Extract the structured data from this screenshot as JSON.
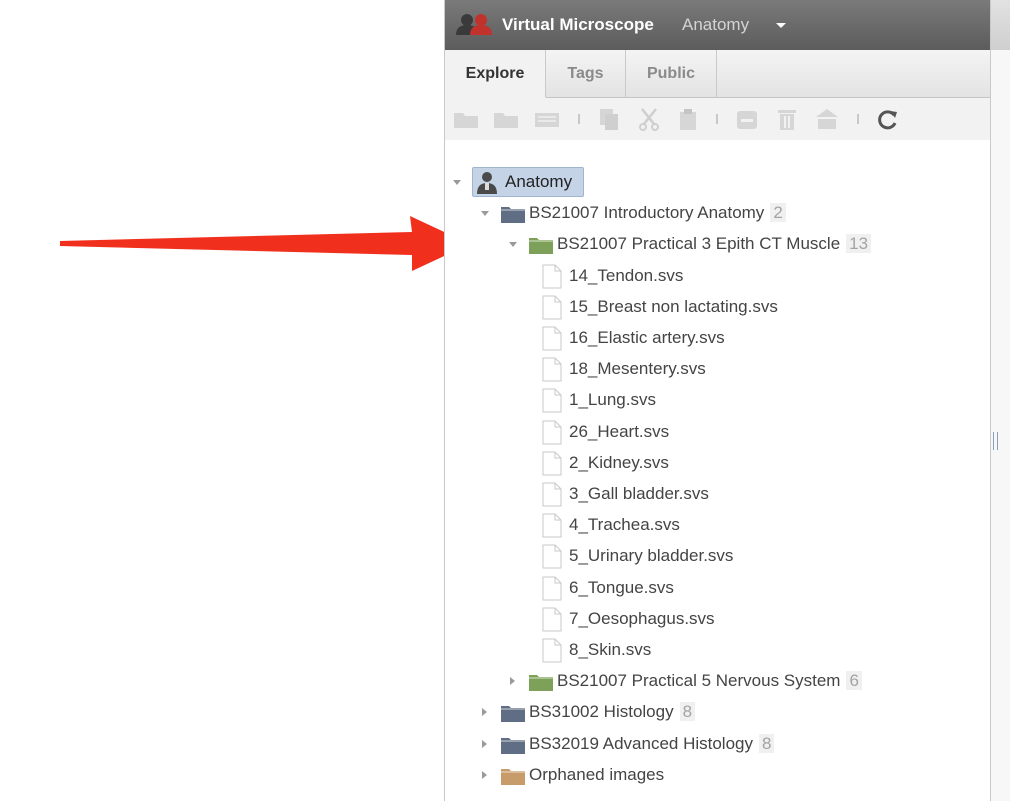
{
  "app": {
    "title": "Virtual Microscope",
    "context": "Anatomy"
  },
  "tabs": [
    {
      "label": "Explore",
      "active": true
    },
    {
      "label": "Tags",
      "active": false
    },
    {
      "label": "Public",
      "active": false
    }
  ],
  "toolbar": {
    "icons": [
      "new-folder-icon",
      "new-project-icon",
      "new-tag-icon",
      "copy-icon",
      "cut-icon",
      "paste-icon",
      "remove-icon",
      "delete-icon",
      "chgrp-icon",
      "refresh-icon"
    ]
  },
  "tree": {
    "root": {
      "label": "Anatomy"
    },
    "items": [
      {
        "label": "BS21007 Introductory Anatomy",
        "count": "2",
        "type": "project"
      },
      {
        "label": "BS21007 Practical 3 Epith CT Muscle",
        "count": "13",
        "type": "dataset"
      },
      {
        "label": "14_Tendon.svs",
        "type": "image"
      },
      {
        "label": "15_Breast non lactating.svs",
        "type": "image"
      },
      {
        "label": "16_Elastic artery.svs",
        "type": "image"
      },
      {
        "label": "18_Mesentery.svs",
        "type": "image"
      },
      {
        "label": "1_Lung.svs",
        "type": "image"
      },
      {
        "label": "26_Heart.svs",
        "type": "image"
      },
      {
        "label": "2_Kidney.svs",
        "type": "image"
      },
      {
        "label": "3_Gall bladder.svs",
        "type": "image"
      },
      {
        "label": "4_Trachea.svs",
        "type": "image"
      },
      {
        "label": "5_Urinary bladder.svs",
        "type": "image"
      },
      {
        "label": "6_Tongue.svs",
        "type": "image"
      },
      {
        "label": "7_Oesophagus.svs",
        "type": "image"
      },
      {
        "label": "8_Skin.svs",
        "type": "image"
      },
      {
        "label": "BS21007 Practical 5 Nervous System",
        "count": "6",
        "type": "dataset"
      },
      {
        "label": "BS31002 Histology",
        "count": "8",
        "type": "project"
      },
      {
        "label": "BS32019 Advanced Histology",
        "count": "8",
        "type": "project"
      },
      {
        "label": "Orphaned images",
        "type": "orphaned"
      }
    ]
  },
  "colors": {
    "arrow": "#f0301c",
    "project_folder": "#5f6e84",
    "dataset_folder": "#7ea15a",
    "orphaned_folder": "#c89b6a",
    "selection": "#c5d3e6"
  }
}
